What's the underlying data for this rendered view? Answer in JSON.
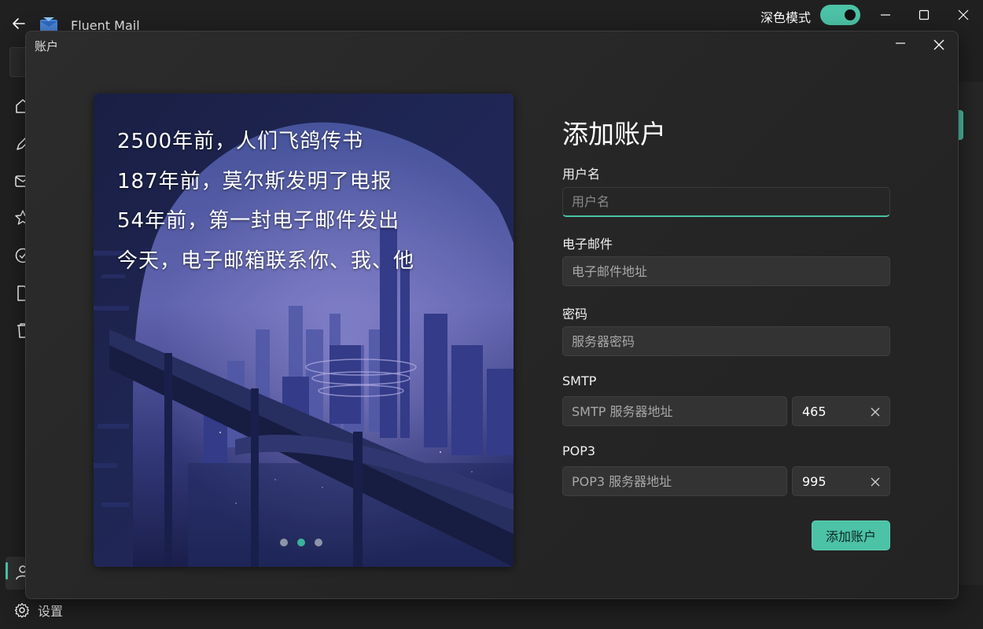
{
  "app": {
    "title": "Fluent Mail",
    "dark_mode_label": "深色模式",
    "dark_mode_on": true
  },
  "nav": {
    "settings_label": "设置"
  },
  "dialog": {
    "title": "账户",
    "banner": {
      "lines": [
        "2500年前，人们飞鸽传书",
        "187年前，莫尔斯发明了电报",
        "54年前，第一封电子邮件发出",
        "今天，电子邮箱联系你、我、他"
      ],
      "slide_count": 3,
      "active_slide": 2
    },
    "form": {
      "heading": "添加账户",
      "username": {
        "label": "用户名",
        "placeholder": "用户名",
        "value": ""
      },
      "email": {
        "label": "电子邮件",
        "placeholder": "电子邮件地址",
        "value": ""
      },
      "password": {
        "label": "密码",
        "placeholder": "服务器密码",
        "value": ""
      },
      "smtp": {
        "label": "SMTP",
        "placeholder": "SMTP 服务器地址",
        "port": "465"
      },
      "pop3": {
        "label": "POP3",
        "placeholder": "POP3 服务器地址",
        "port": "995"
      },
      "submit_label": "添加账户"
    }
  },
  "colors": {
    "accent": "#4cc2a6",
    "background": "#202020",
    "dialog": "#2a2a2a",
    "input": "#333333"
  }
}
